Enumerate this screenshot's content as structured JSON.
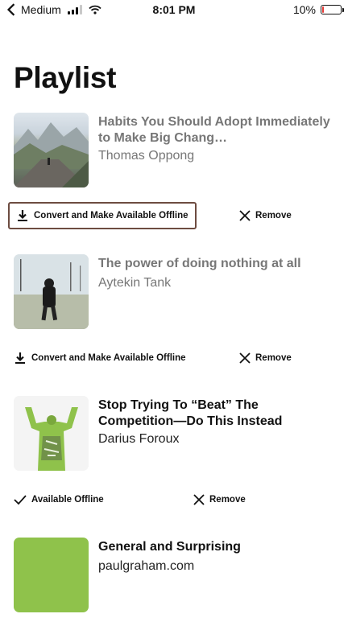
{
  "status_bar": {
    "carrier": "Medium",
    "time": "8:01 PM",
    "battery_percent": "10%",
    "battery_level": 0.1,
    "battery_color": "#e53935"
  },
  "page": {
    "title": "Playlist"
  },
  "items": [
    {
      "title": "Habits You Should Adopt Immediately to Make Big Chang…",
      "author": "Thomas Oppong",
      "action_label": "Convert and Make Available Offline",
      "action_icon": "download-icon",
      "remove_label": "Remove"
    },
    {
      "title": "The power of doing nothing at all",
      "author": "Aytekin Tank",
      "action_label": "Convert and Make Available Offline",
      "action_icon": "download-icon",
      "remove_label": "Remove"
    },
    {
      "title": "Stop Trying To “Beat” The Competition—Do This Instead",
      "author": "Darius Foroux",
      "action_label": "Available Offline",
      "action_icon": "checkmark-icon",
      "remove_label": "Remove"
    },
    {
      "title": "General and Surprising",
      "author": "paulgraham.com"
    }
  ],
  "colors": {
    "highlight_border": "#6d4c41",
    "thumbnail_green": "#8fc24b"
  }
}
